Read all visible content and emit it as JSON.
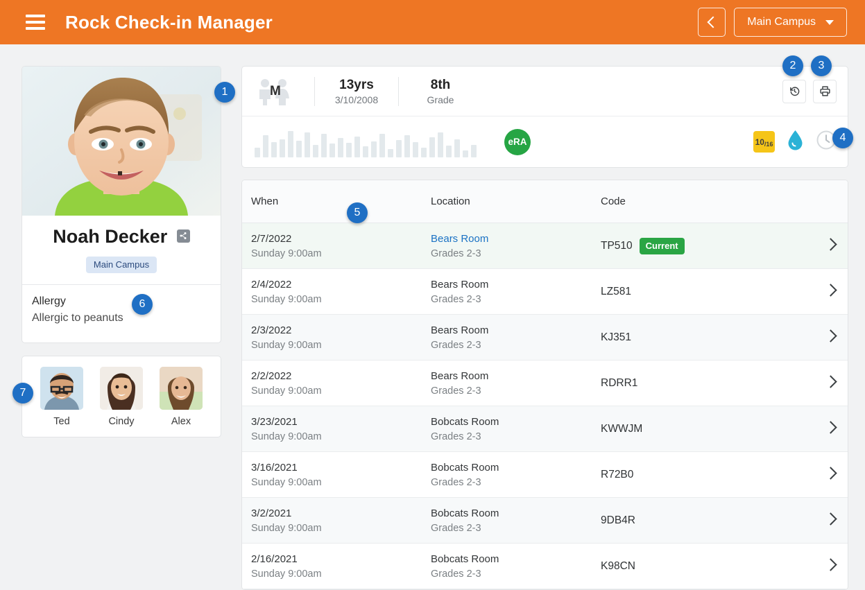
{
  "header": {
    "title": "Rock Check-in Manager",
    "menu_icon": "hamburger-icon",
    "back_label": "",
    "campus_label": "Main Campus"
  },
  "profile": {
    "name": "Noah Decker",
    "share_icon": "share-icon",
    "campus_chip": "Main Campus",
    "allergy_title": "Allergy",
    "allergy_text": "Allergic to peanuts",
    "photo_alt": "photo of Noah Decker"
  },
  "family": {
    "members": [
      {
        "name": "Ted"
      },
      {
        "name": "Cindy"
      },
      {
        "name": "Alex"
      }
    ]
  },
  "info": {
    "gender_letter": "M",
    "gender_icon": "gender-figures-icon",
    "age_value": "13yrs",
    "age_sub": "3/10/2008",
    "grade_value": "8th",
    "grade_sub": "Grade",
    "history_icon": "history-icon",
    "print_icon": "printer-icon"
  },
  "attendance": {
    "era_label": "eRA",
    "ratio_main": "10",
    "ratio_sub": "/16",
    "drop_icon": "water-drop-icon",
    "clock_icon": "clock-icon",
    "bars": [
      14,
      32,
      22,
      26,
      38,
      24,
      36,
      18,
      34,
      20,
      28,
      21,
      30,
      16,
      23,
      34,
      12,
      25,
      32,
      22,
      14,
      29,
      36,
      17,
      26,
      10,
      18
    ]
  },
  "table": {
    "columns": [
      "When",
      "Location",
      "Code"
    ],
    "rows": [
      {
        "date": "2/7/2022",
        "time": "Sunday 9:00am",
        "location": "Bears Room",
        "grades": "Grades 2-3",
        "code": "TP510",
        "badge": "Current",
        "current": true,
        "link": true
      },
      {
        "date": "2/4/2022",
        "time": "Sunday 9:00am",
        "location": "Bears Room",
        "grades": "Grades 2-3",
        "code": "LZ581",
        "badge": "",
        "current": false,
        "link": false
      },
      {
        "date": "2/3/2022",
        "time": "Sunday 9:00am",
        "location": "Bears Room",
        "grades": "Grades 2-3",
        "code": "KJ351",
        "badge": "",
        "current": false,
        "link": false
      },
      {
        "date": "2/2/2022",
        "time": "Sunday 9:00am",
        "location": "Bears Room",
        "grades": "Grades 2-3",
        "code": "RDRR1",
        "badge": "",
        "current": false,
        "link": false
      },
      {
        "date": "3/23/2021",
        "time": "Sunday 9:00am",
        "location": "Bobcats Room",
        "grades": "Grades 2-3",
        "code": "KWWJM",
        "badge": "",
        "current": false,
        "link": false
      },
      {
        "date": "3/16/2021",
        "time": "Sunday 9:00am",
        "location": "Bobcats Room",
        "grades": "Grades 2-3",
        "code": "R72B0",
        "badge": "",
        "current": false,
        "link": false
      },
      {
        "date": "3/2/2021",
        "time": "Sunday 9:00am",
        "location": "Bobcats Room",
        "grades": "Grades 2-3",
        "code": "9DB4R",
        "badge": "",
        "current": false,
        "link": false
      },
      {
        "date": "2/16/2021",
        "time": "Sunday 9:00am",
        "location": "Bobcats Room",
        "grades": "Grades 2-3",
        "code": "K98CN",
        "badge": "",
        "current": false,
        "link": false
      }
    ]
  },
  "callouts": [
    {
      "id": "cal1",
      "label": "1"
    },
    {
      "id": "cal2",
      "label": "2"
    },
    {
      "id": "cal3",
      "label": "3"
    },
    {
      "id": "cal4",
      "label": "4"
    },
    {
      "id": "cal5",
      "label": "5"
    },
    {
      "id": "cal6",
      "label": "6"
    },
    {
      "id": "cal7",
      "label": "7"
    }
  ],
  "colors": {
    "brand_orange": "#ee7624",
    "accent_blue": "#1f6fc4",
    "success_green": "#2aa544",
    "warning_yellow": "#f5c518",
    "link_blue": "#1b72c4"
  }
}
